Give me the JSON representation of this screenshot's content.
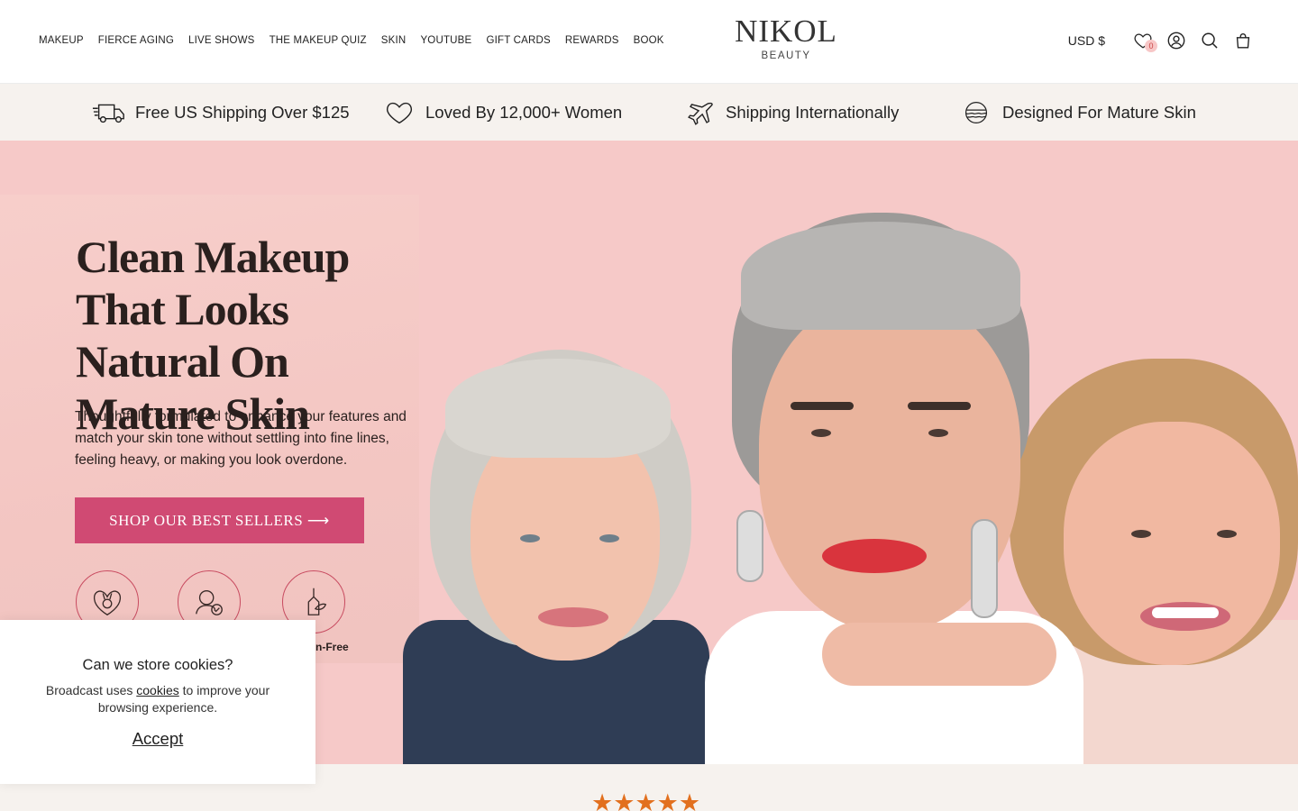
{
  "header": {
    "nav": [
      "MAKEUP",
      "FIERCE AGING",
      "LIVE SHOWS",
      "THE MAKEUP QUIZ",
      "SKIN",
      "YOUTUBE",
      "GIFT CARDS",
      "REWARDS",
      "BOOK"
    ],
    "logo_main": "NIKOL",
    "logo_sub": "BEAUTY",
    "currency": "USD $",
    "wishlist_count": "0",
    "icons": [
      "heart-icon",
      "account-icon",
      "search-icon",
      "bag-icon"
    ]
  },
  "benefits": [
    {
      "icon": "truck-icon",
      "label": "Free US Shipping Over $125"
    },
    {
      "icon": "heart-icon",
      "label": "Loved By 12,000+ Women"
    },
    {
      "icon": "plane-icon",
      "label": "Shipping Internationally"
    },
    {
      "icon": "skin-icon",
      "label": "Designed For Mature Skin"
    }
  ],
  "hero": {
    "title": "Clean Makeup That Looks Natural On Mature Skin",
    "subtitle": "Thoughtfully formulated to enhance your features and match your skin tone without settling into fine lines, feeling heavy, or making you look overdone.",
    "cta": "SHOP OUR BEST SELLERS ⟶",
    "badge_label_partial": "n-Free",
    "colors": {
      "background": "#f6c9c8",
      "cta": "#d04a73"
    }
  },
  "cookie": {
    "title": "Can we store cookies?",
    "text_before": "Broadcast uses ",
    "link": "cookies",
    "text_after": " to improve your browsing experience.",
    "accept": "Accept"
  },
  "reviews": {
    "stars": "★★★★★"
  }
}
